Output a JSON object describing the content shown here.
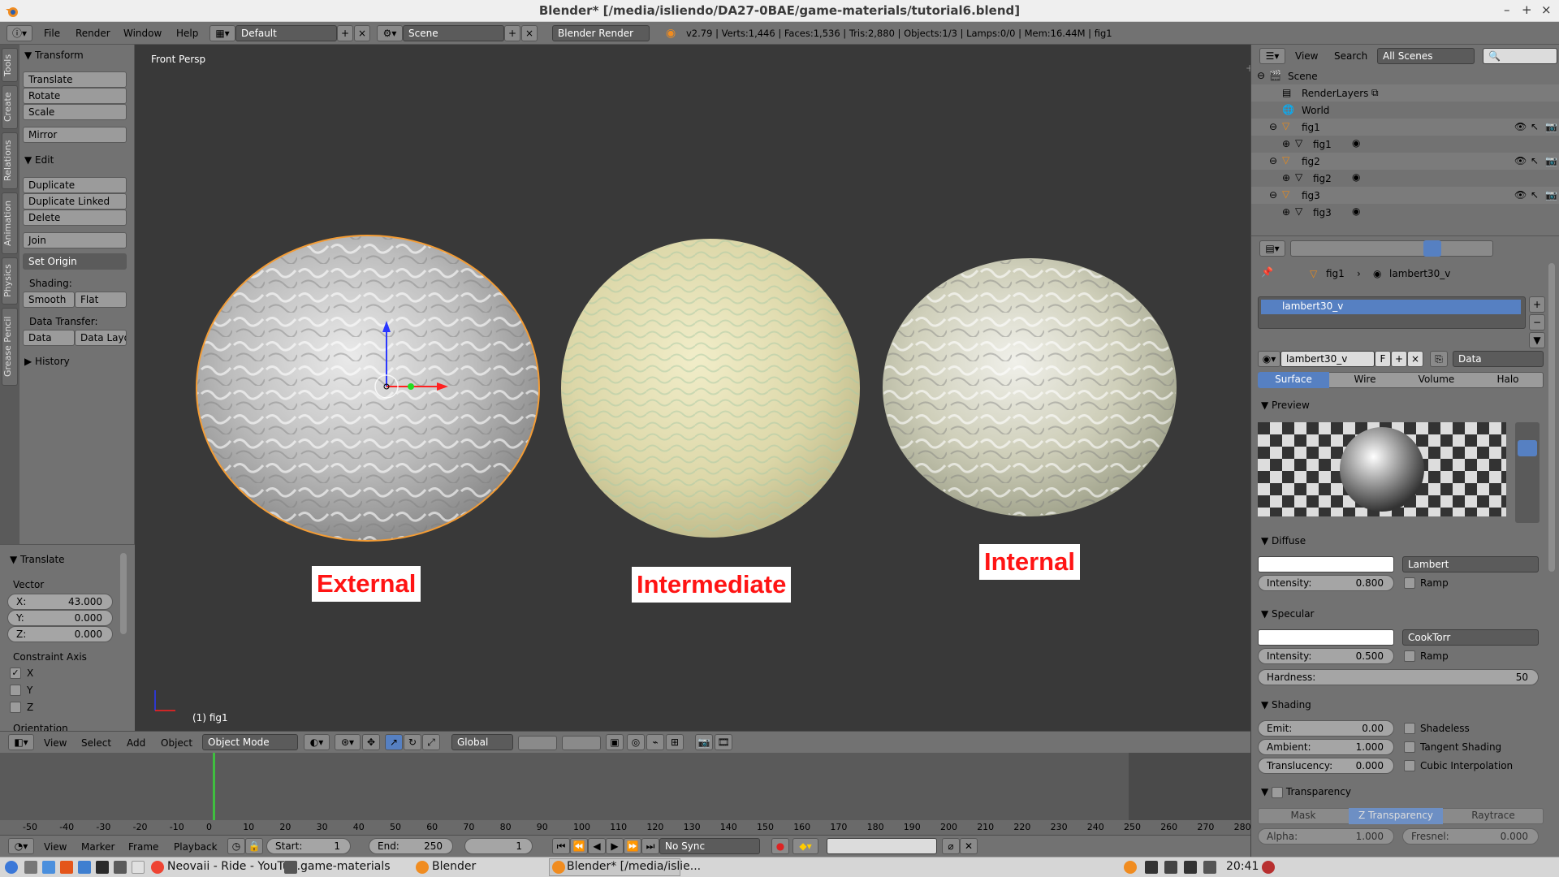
{
  "window": {
    "title": "Blender* [/media/isliendo/DA27-0BAE/game-materials/tutorial6.blend]",
    "controls": [
      "–",
      "+",
      "×"
    ]
  },
  "infobar": {
    "menus": [
      "File",
      "Render",
      "Window",
      "Help"
    ],
    "layout": "Default",
    "scene": "Scene",
    "engine": "Blender Render",
    "stats": "v2.79 | Verts:1,446 | Faces:1,536 | Tris:2,880 | Objects:1/3 | Lamps:0/0 | Mem:16.44M | fig1"
  },
  "tabs": [
    "Tools",
    "Create",
    "Relations",
    "Animation",
    "Physics",
    "Grease Pencil"
  ],
  "toolshelf": {
    "transform_header": "Transform",
    "transform_buttons": [
      "Translate",
      "Rotate",
      "Scale"
    ],
    "mirror": "Mirror",
    "edit_header": "Edit",
    "edit_buttons": [
      "Duplicate",
      "Duplicate Linked",
      "Delete"
    ],
    "join": "Join",
    "set_origin": "Set Origin",
    "shading_label": "Shading:",
    "smooth": "Smooth",
    "flat": "Flat",
    "data_transfer_label": "Data Transfer:",
    "data": "Data",
    "data_layout": "Data Layo",
    "history": "History"
  },
  "operator": {
    "header": "Translate",
    "vector_label": "Vector",
    "x_label": "X:",
    "x": "43.000",
    "y_label": "Y:",
    "y": "0.000",
    "z_label": "Z:",
    "z": "0.000",
    "constraint_label": "Constraint Axis",
    "axes": [
      "X",
      "Y",
      "Z"
    ],
    "orientation": "Orientation"
  },
  "viewport": {
    "view_name": "Front Persp",
    "object_info": "(1) fig1",
    "labels": [
      "External",
      "Intermediate",
      "Internal"
    ]
  },
  "vpheader": {
    "menus": [
      "View",
      "Select",
      "Add",
      "Object"
    ],
    "mode": "Object Mode",
    "orientation": "Global"
  },
  "timeline": {
    "ticks": [
      "-50",
      "-40",
      "-30",
      "-20",
      "-10",
      "0",
      "10",
      "20",
      "30",
      "40",
      "50",
      "60",
      "70",
      "80",
      "90",
      "100",
      "110",
      "120",
      "130",
      "140",
      "150",
      "160",
      "170",
      "180",
      "190",
      "200",
      "210",
      "220",
      "230",
      "240",
      "250",
      "260",
      "270",
      "280"
    ],
    "menus": [
      "View",
      "Marker",
      "Frame",
      "Playback"
    ],
    "start_label": "Start:",
    "start": "1",
    "end_label": "End:",
    "end": "250",
    "current": "1",
    "sync": "No Sync"
  },
  "outliner": {
    "menus": [
      "View",
      "Search"
    ],
    "filter": "All Scenes",
    "items": [
      {
        "label": "Scene"
      },
      {
        "label": "RenderLayers"
      },
      {
        "label": "World"
      },
      {
        "label": "fig1"
      },
      {
        "label": "fig1"
      },
      {
        "label": "fig2"
      },
      {
        "label": "fig2"
      },
      {
        "label": "fig3"
      },
      {
        "label": "fig3"
      }
    ]
  },
  "properties": {
    "breadcrumb_object": "fig1",
    "breadcrumb_material": "lambert30_v",
    "slot_name": "lambert30_v",
    "material_name": "lambert30_v",
    "fake_user": "F",
    "link": "Data",
    "tabs": [
      "Surface",
      "Wire",
      "Volume",
      "Halo"
    ],
    "preview_header": "Preview",
    "diffuse_header": "Diffuse",
    "diffuse_shader": "Lambert",
    "diffuse_intensity_label": "Intensity:",
    "diffuse_intensity": "0.800",
    "ramp": "Ramp",
    "specular_header": "Specular",
    "specular_shader": "CookTorr",
    "specular_intensity_label": "Intensity:",
    "specular_intensity": "0.500",
    "hardness_label": "Hardness:",
    "hardness": "50",
    "shading_header": "Shading",
    "emit_label": "Emit:",
    "emit": "0.00",
    "ambient_label": "Ambient:",
    "ambient": "1.000",
    "translucency_label": "Translucency:",
    "translucency": "0.000",
    "shadeless": "Shadeless",
    "tangent_shading": "Tangent Shading",
    "cubic_interpolation": "Cubic Interpolation",
    "transparency_header": "Transparency",
    "transp_tabs": [
      "Mask",
      "Z Transparency",
      "Raytrace"
    ],
    "alpha_label": "Alpha:",
    "alpha": "1.000",
    "fresnel_label": "Fresnel:",
    "fresnel": "0.000"
  },
  "taskbar": {
    "items": [
      "Neovaii - Ride - YouTu...",
      "game-materials",
      "Blender",
      "Blender* [/media/islie..."
    ],
    "clock": "20:41"
  },
  "colors": {
    "panel": "#727272",
    "viewport": "#393939",
    "accent_blue": "#5680c2",
    "label_red": "#ff1414",
    "selection_orange": "#f39c35"
  }
}
